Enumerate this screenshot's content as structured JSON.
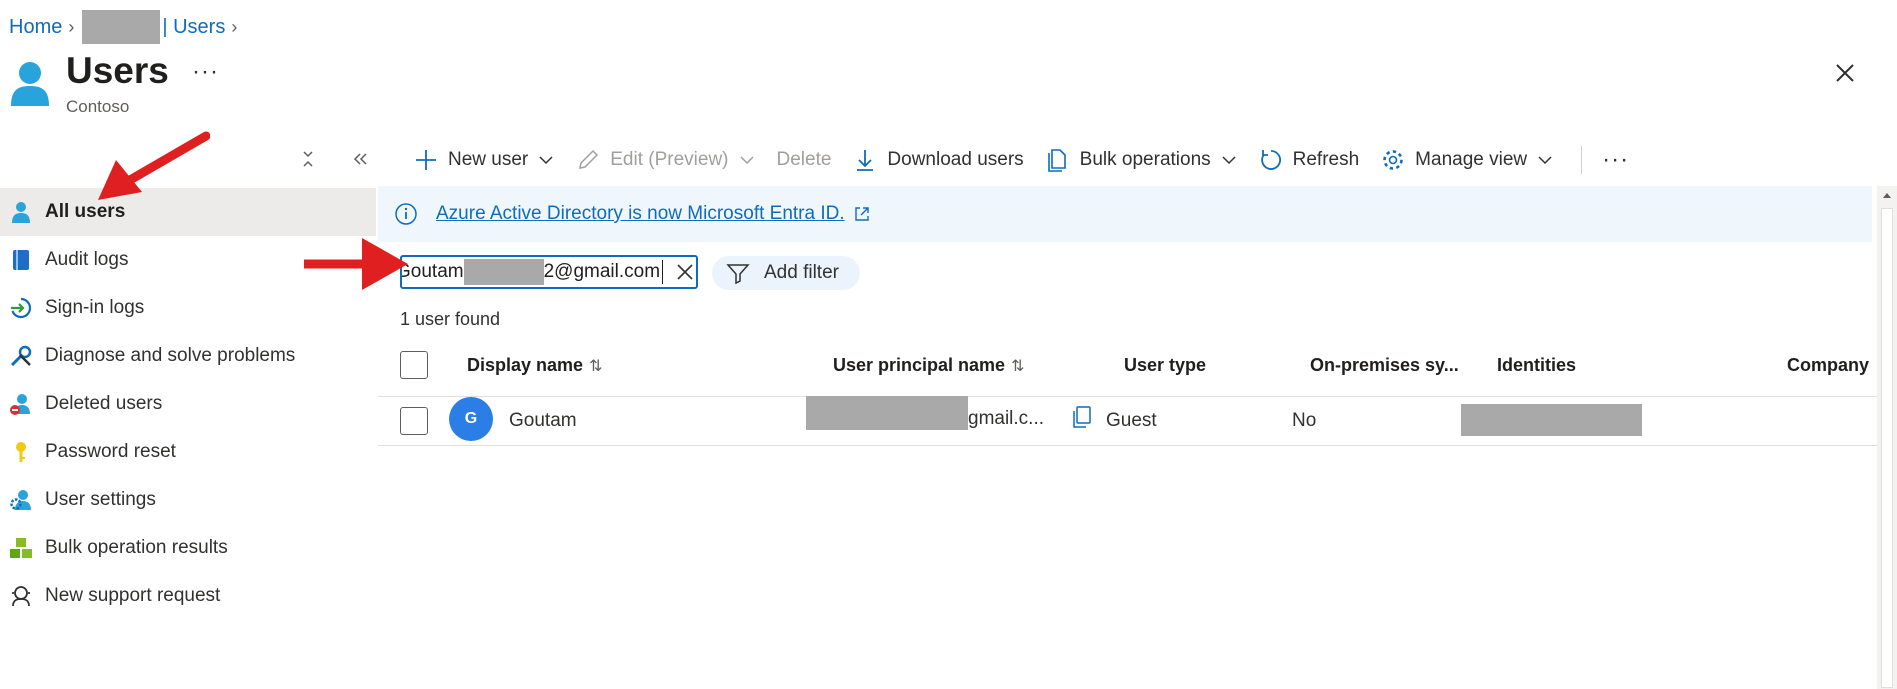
{
  "breadcrumb": {
    "home": "Home",
    "users": "| Users"
  },
  "header": {
    "title": "Users",
    "subtitle": "Contoso",
    "more": "···"
  },
  "sidebar": {
    "items": [
      {
        "label": "All users",
        "icon": "user-icon",
        "active": true
      },
      {
        "label": "Audit logs",
        "icon": "book-icon"
      },
      {
        "label": "Sign-in logs",
        "icon": "sign-in-icon"
      },
      {
        "label": "Diagnose and solve problems",
        "icon": "wrench-icon"
      },
      {
        "label": "Deleted users",
        "icon": "deleted-user-icon"
      },
      {
        "label": "Password reset",
        "icon": "key-icon"
      },
      {
        "label": "User settings",
        "icon": "user-settings-icon"
      },
      {
        "label": "Bulk operation results",
        "icon": "cubes-icon"
      },
      {
        "label": "New support request",
        "icon": "support-icon"
      }
    ]
  },
  "toolbar": {
    "new_user": "New user",
    "edit": "Edit (Preview)",
    "delete": "Delete",
    "download": "Download users",
    "bulk": "Bulk operations",
    "refresh": "Refresh",
    "manage_view": "Manage view",
    "more": "···"
  },
  "banner": {
    "text": "Azure Active Directory is now Microsoft Entra ID."
  },
  "search": {
    "prefix": "Goutam",
    "suffix": "2@gmail.com"
  },
  "filter": {
    "label": "Add filter"
  },
  "results": {
    "count_text": "1 user found"
  },
  "table": {
    "columns": [
      "Display name",
      "User principal name",
      "User type",
      "On-premises sy...",
      "Identities",
      "Company"
    ],
    "rows": [
      {
        "avatar": "G",
        "display_name": "Goutam",
        "upn_suffix": "gmail.c...",
        "user_type": "Guest",
        "on_prem": "No"
      }
    ]
  },
  "colors": {
    "accent": "#0f6cbd",
    "banner_bg": "#eff6fc",
    "avatar": "#2b7ee5",
    "arrow": "#e02020"
  }
}
